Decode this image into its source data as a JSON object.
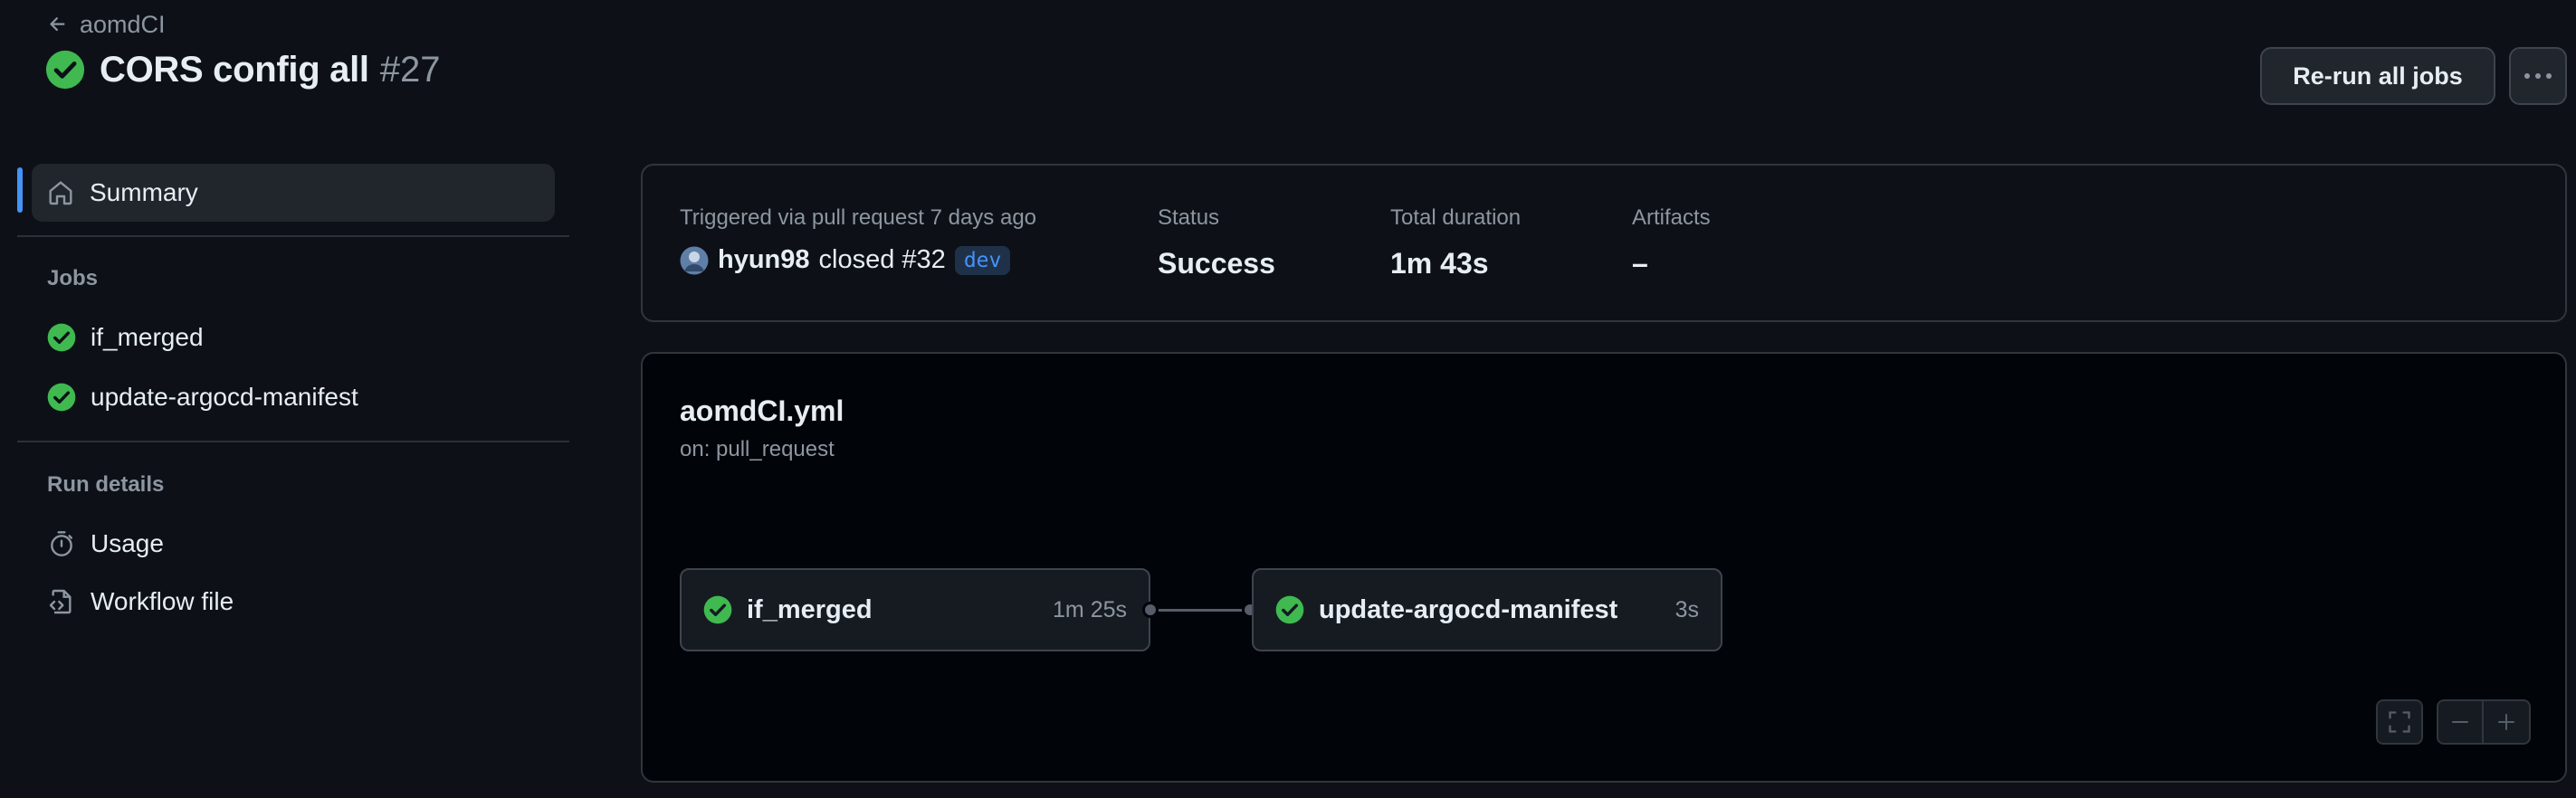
{
  "header": {
    "back_label": "aomdCI",
    "run_title": "CORS config all",
    "run_number": "#27",
    "rerun_label": "Re-run all jobs",
    "more_icon": "kebab-horizontal-icon"
  },
  "sidebar": {
    "summary_label": "Summary",
    "jobs_heading": "Jobs",
    "jobs": [
      {
        "label": "if_merged",
        "status": "success"
      },
      {
        "label": "update-argocd-manifest",
        "status": "success"
      }
    ],
    "run_details_heading": "Run details",
    "details": [
      {
        "label": "Usage",
        "icon": "stopwatch-icon"
      },
      {
        "label": "Workflow file",
        "icon": "file-code-icon"
      }
    ]
  },
  "summary": {
    "trigger_label": "Triggered via pull request 7 days ago",
    "actor": "hyun98",
    "action": "closed #32",
    "branch": "dev",
    "status_label": "Status",
    "status_value": "Success",
    "duration_label": "Total duration",
    "duration_value": "1m 43s",
    "artifacts_label": "Artifacts",
    "artifacts_value": "–"
  },
  "graph": {
    "workflow_file": "aomdCI.yml",
    "trigger": "on: pull_request",
    "jobs": [
      {
        "name": "if_merged",
        "duration": "1m 25s"
      },
      {
        "name": "update-argocd-manifest",
        "duration": "3s"
      }
    ]
  },
  "colors": {
    "background": "#0d1117",
    "success": "#3fb950",
    "accent": "#4493f8"
  }
}
